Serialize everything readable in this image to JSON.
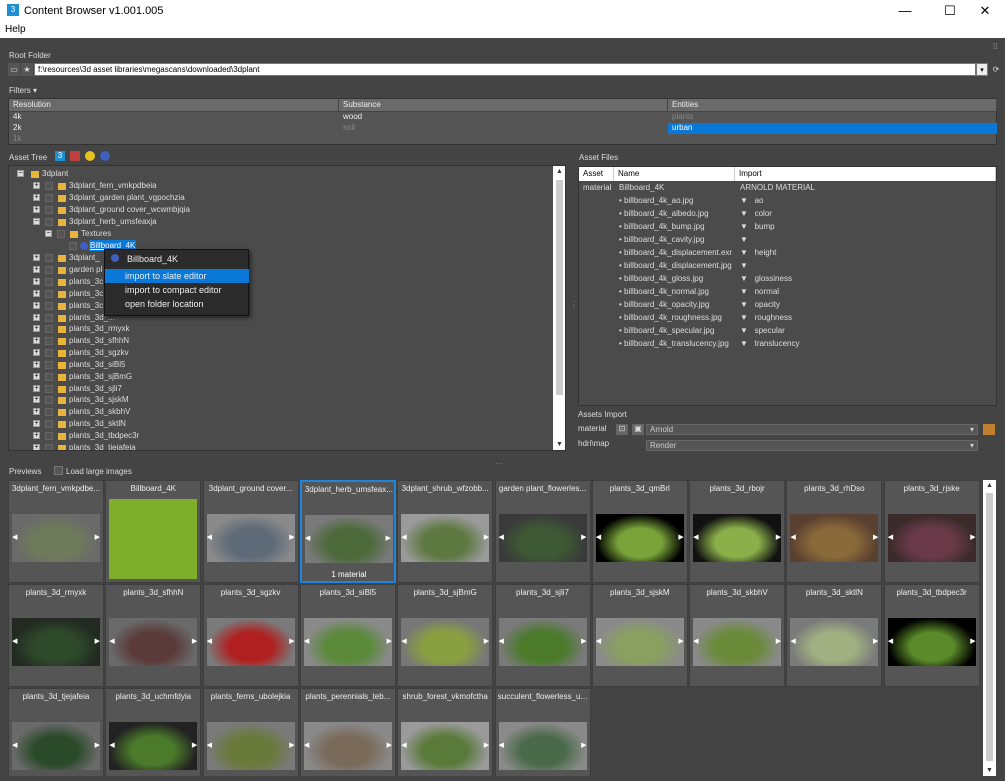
{
  "window": {
    "title": "Content Browser v1.001.005",
    "app_icon": "3",
    "minimize": "—",
    "maximize": "☐",
    "close": "✕"
  },
  "menu": {
    "help": "Help"
  },
  "root_folder": {
    "label": "Root Folder",
    "path": "f:\\resources\\3d asset libraries\\megascans\\downloaded\\3dplant"
  },
  "filters": {
    "label": "Filters",
    "columns": [
      {
        "header": "Resolution",
        "items": [
          "4k",
          "2k",
          "1k"
        ]
      },
      {
        "header": "Substance",
        "items": [
          "wood",
          "soil"
        ]
      },
      {
        "header": "Entities",
        "items": [
          "plants",
          "urban"
        ]
      }
    ]
  },
  "asset_tree": {
    "label": "Asset Tree",
    "root": "3dplant",
    "rows": [
      "3dplant_fern_vmkpdbeia",
      "3dplant_garden plant_vgpochzia",
      "3dplant_ground cover_wcwmbjqia",
      "3dplant_herb_umsfeaxja",
      "Textures",
      "Billboard_4K",
      "3dplant_",
      "garden pl",
      "plants_3c",
      "plants_3c",
      "plants_3c",
      "plants_3d_...",
      "plants_3d_rmyxk",
      "plants_3d_sfhhN",
      "plants_3d_sgzkv",
      "plants_3d_siBl5",
      "plants_3d_sjBmG",
      "plants_3d_sjli7",
      "plants_3d_sjskM",
      "plants_3d_skbhV",
      "plants_3d_sktlN",
      "plants_3d_tbdpec3r",
      "plants_3d_tjejafeia"
    ]
  },
  "context_menu": {
    "title": "Billboard_4K",
    "items": [
      "import to slate editor",
      "import to compact editor",
      "open folder location"
    ]
  },
  "asset_files": {
    "label": "Asset Files",
    "headers": [
      "Asset",
      "Name",
      "Import"
    ],
    "material_row": {
      "asset": "material",
      "name": "Billboard_4K",
      "import": "ARNOLD MATERIAL"
    },
    "rows": [
      {
        "name": "billboard_4k_ao.jpg",
        "import": "ao"
      },
      {
        "name": "billboard_4k_albedo.jpg",
        "import": "color"
      },
      {
        "name": "billboard_4k_bump.jpg",
        "import": "bump"
      },
      {
        "name": "billboard_4k_cavity.jpg",
        "import": ""
      },
      {
        "name": "billboard_4k_displacement.exr",
        "import": "height"
      },
      {
        "name": "billboard_4k_displacement.jpg",
        "import": ""
      },
      {
        "name": "billboard_4k_gloss.jpg",
        "import": "glossiness"
      },
      {
        "name": "billboard_4k_normal.jpg",
        "import": "normal"
      },
      {
        "name": "billboard_4k_opacity.jpg",
        "import": "opacity"
      },
      {
        "name": "billboard_4k_roughness.jpg",
        "import": "roughness"
      },
      {
        "name": "billboard_4k_specular.jpg",
        "import": "specular"
      },
      {
        "name": "billboard_4k_translucency.jpg",
        "import": "translucency"
      }
    ]
  },
  "assets_import": {
    "label": "Assets Import",
    "material_label": "material",
    "material_value": "Arnold",
    "hdri_label": "hdri\\map",
    "hdri_value": "Render"
  },
  "previews": {
    "label": "Previews",
    "large_images": "Load large images",
    "tiles": [
      {
        "name": "3dplant_fern_vmkpdbe...",
        "color": "#6f7a5a",
        "bg": "#6a6a6a"
      },
      {
        "name": "Billboard_4K",
        "color": "#7fae2a",
        "bg": "#7fae2a"
      },
      {
        "name": "3dplant_ground cover...",
        "color": "#5e6a78",
        "bg": "#8a8a8a"
      },
      {
        "name": "3dplant_herb_umsfeax...",
        "color": "#4c6a3a",
        "bg": "#7a7a7a",
        "badge": "1 material"
      },
      {
        "name": "3dplant_shrub_wfzobb...",
        "color": "#5d7840",
        "bg": "#9a9a9a"
      },
      {
        "name": "garden plant_flowerles...",
        "color": "#3e5a34",
        "bg": "#3a3a3a"
      },
      {
        "name": "plants_3d_qmBrl",
        "color": "#7aa43a",
        "bg": "#000000"
      },
      {
        "name": "plants_3d_rbojr",
        "color": "#8bb04a",
        "bg": "#111111"
      },
      {
        "name": "plants_3d_rhDso",
        "color": "#8a6a3a",
        "bg": "#5a4030"
      },
      {
        "name": "plants_3d_rjske",
        "color": "#6a3a4a",
        "bg": "#3a2a2a"
      },
      {
        "name": "plants_3d_rmyxk",
        "color": "#2e4a2a",
        "bg": "#222a22"
      },
      {
        "name": "plants_3d_sfhhN",
        "color": "#5a3a3a",
        "bg": "#6a6a6a"
      },
      {
        "name": "plants_3d_sgzkv",
        "color": "#b02020",
        "bg": "#7a7a7a"
      },
      {
        "name": "plants_3d_siBl5",
        "color": "#5a8a3a",
        "bg": "#8a8a8a"
      },
      {
        "name": "plants_3d_sjBmG",
        "color": "#8aa040",
        "bg": "#777777"
      },
      {
        "name": "plants_3d_sjli7",
        "color": "#4a7a2a",
        "bg": "#7a7a7a"
      },
      {
        "name": "plants_3d_sjskM",
        "color": "#8aa060",
        "bg": "#8a8a8a"
      },
      {
        "name": "plants_3d_skbhV",
        "color": "#6a8a3a",
        "bg": "#8a8a8a"
      },
      {
        "name": "plants_3d_sktlN",
        "color": "#a0b080",
        "bg": "#7a7a7a"
      },
      {
        "name": "plants_3d_tbdpec3r",
        "color": "#5a8a2a",
        "bg": "#000000"
      },
      {
        "name": "plants_3d_tjejafeia",
        "color": "#2a4a2a",
        "bg": "#6a6a6a"
      },
      {
        "name": "plants_3d_uchmfdyia",
        "color": "#4a7a2a",
        "bg": "#222222"
      },
      {
        "name": "plants_ferns_ubolejkia",
        "color": "#6a7a3a",
        "bg": "#7a7a7a"
      },
      {
        "name": "plants_perennials_teb...",
        "color": "#7a6a5a",
        "bg": "#8a8a8a"
      },
      {
        "name": "shrub_forest_vkmofctha",
        "color": "#5a7a3a",
        "bg": "#9a9a9a"
      },
      {
        "name": "succulent_flowerless_u...",
        "color": "#4a6a4a",
        "bg": "#8a8a8a"
      }
    ]
  },
  "colors": {
    "accent": "#0a78d7",
    "panel": "#4b4b4b",
    "folder": "#e8b43a"
  }
}
